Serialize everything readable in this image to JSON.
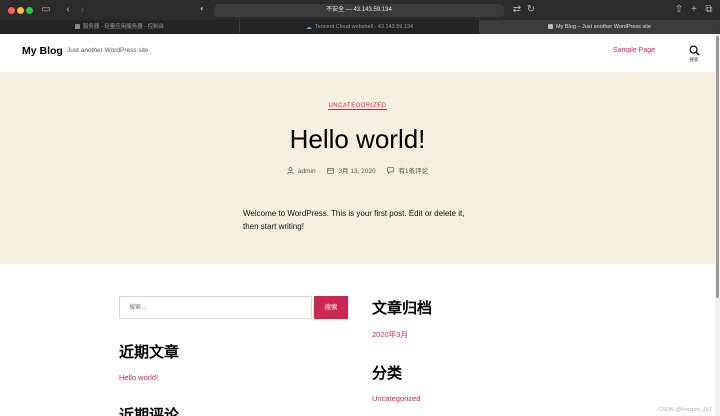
{
  "browser": {
    "address_text": "不安全 — 43.143.59.134",
    "tabs": [
      {
        "label": "服务器 - 轻量应用服务器 - 控制台"
      },
      {
        "label": "Tencent Cloud webshell - 43.143.59.134"
      },
      {
        "label": "My Blog – Just another WordPress site"
      }
    ]
  },
  "site": {
    "title": "My Blog",
    "description": "Just another WordPress site",
    "nav": {
      "sample_page": "Sample Page"
    },
    "search_label": "搜索"
  },
  "post": {
    "category": "UNCATEGORIZED",
    "title": "Hello world!",
    "author": "admin",
    "date": "3月 13, 2020",
    "comments": "有1条评论",
    "content": "Welcome to WordPress. This is your first post. Edit or delete it, then start writing!"
  },
  "widgets": {
    "search": {
      "placeholder": "搜索…",
      "button": "搜索"
    },
    "recent_posts": {
      "title": "近期文章",
      "items": [
        "Hello world!"
      ]
    },
    "recent_comments": {
      "title": "近期评论"
    },
    "archives": {
      "title": "文章归档",
      "items": [
        "2020年3月"
      ]
    },
    "categories": {
      "title": "分类",
      "items": [
        "Uncategorized"
      ]
    }
  },
  "watermark": "CSDN @Horizon_157",
  "colors": {
    "accent": "#cd2653",
    "hero_bg": "#f5efe0"
  }
}
